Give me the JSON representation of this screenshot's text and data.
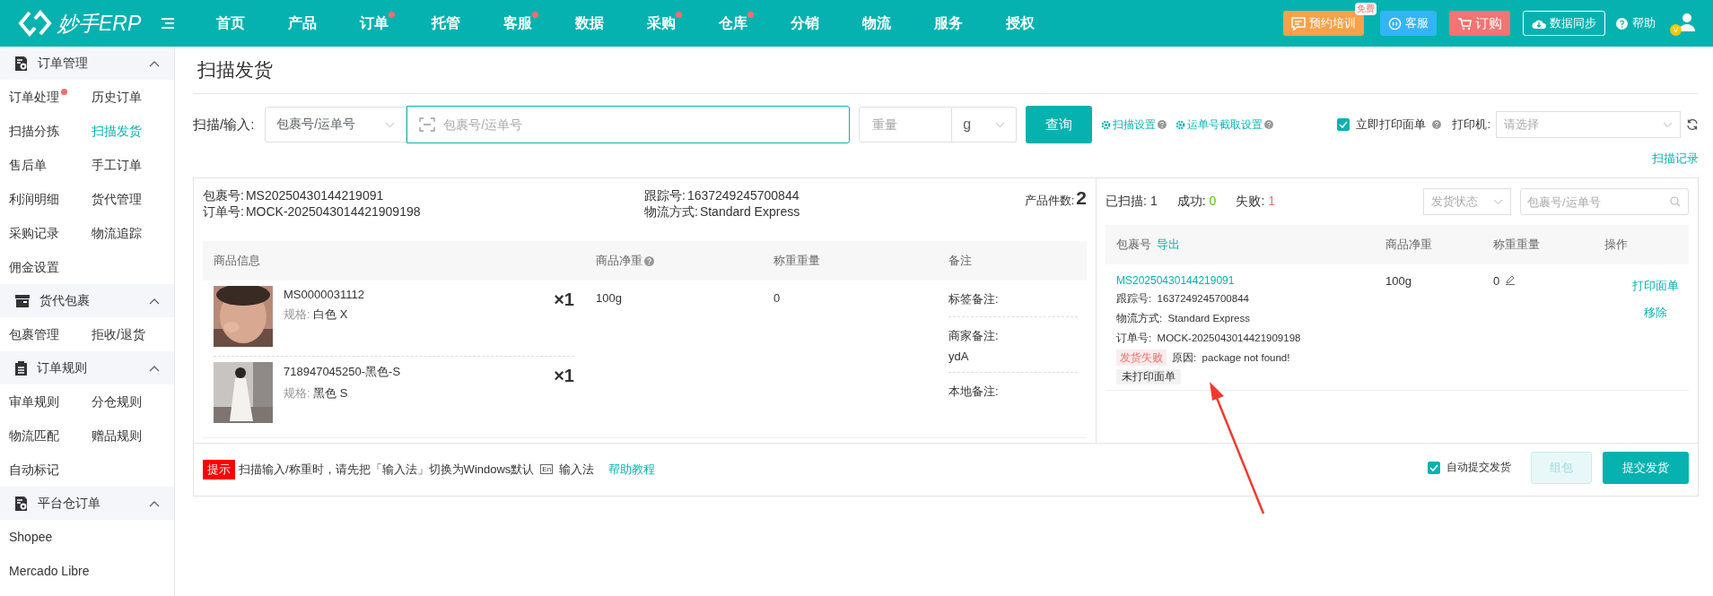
{
  "nav": {
    "logo": "妙手ERP",
    "items": [
      {
        "label": "首页",
        "dot": false
      },
      {
        "label": "产品",
        "dot": false
      },
      {
        "label": "订单",
        "dot": true
      },
      {
        "label": "托管",
        "dot": false
      },
      {
        "label": "客服",
        "dot": true
      },
      {
        "label": "数据",
        "dot": false
      },
      {
        "label": "采购",
        "dot": true
      },
      {
        "label": "仓库",
        "dot": true
      },
      {
        "label": "分销",
        "dot": false
      },
      {
        "label": "物流",
        "dot": false
      },
      {
        "label": "服务",
        "dot": false
      },
      {
        "label": "授权",
        "dot": false
      }
    ],
    "training": {
      "label": "预约培训",
      "badge": "免费"
    },
    "service": "客服",
    "order": "订购",
    "sync": "数据同步",
    "help": "帮助",
    "avatar_badge": "V"
  },
  "sidebar": {
    "groups": [
      {
        "title": "订单管理",
        "expanded": true,
        "items": [
          {
            "label": "订单处理",
            "dot": true,
            "selected": false
          },
          {
            "label": "历史订单",
            "dot": false,
            "selected": false
          },
          {
            "label": "扫描分拣",
            "dot": false,
            "selected": false
          },
          {
            "label": "扫描发货",
            "dot": false,
            "selected": true
          },
          {
            "label": "售后单",
            "dot": false,
            "selected": false
          },
          {
            "label": "手工订单",
            "dot": false,
            "selected": false
          },
          {
            "label": "利润明细",
            "dot": false,
            "selected": false
          },
          {
            "label": "货代管理",
            "dot": false,
            "selected": false
          },
          {
            "label": "采购记录",
            "dot": false,
            "selected": false
          },
          {
            "label": "物流追踪",
            "dot": false,
            "selected": false
          },
          {
            "label": "佣金设置",
            "dot": false,
            "selected": false
          }
        ]
      },
      {
        "title": "货代包裹",
        "expanded": true,
        "items": [
          {
            "label": "包裹管理",
            "dot": false,
            "selected": false
          },
          {
            "label": "拒收/退货",
            "dot": false,
            "selected": false
          }
        ]
      },
      {
        "title": "订单规则",
        "expanded": true,
        "items": [
          {
            "label": "审单规则",
            "dot": false,
            "selected": false
          },
          {
            "label": "分仓规则",
            "dot": false,
            "selected": false
          },
          {
            "label": "物流匹配",
            "dot": false,
            "selected": false
          },
          {
            "label": "赠品规则",
            "dot": false,
            "selected": false
          },
          {
            "label": "自动标记",
            "dot": false,
            "selected": false
          }
        ]
      },
      {
        "title": "平台仓订单",
        "expanded": true,
        "items": [
          {
            "label": "Shopee",
            "dot": false,
            "selected": false
          },
          {
            "label": "Mercado Libre",
            "dot": false,
            "selected": false
          }
        ]
      }
    ]
  },
  "page_title": "扫描发货",
  "scan_bar": {
    "label": "扫描/输入:",
    "type_select": "包裹号/运单号",
    "input_placeholder": "包裹号/运单号",
    "weight_placeholder": "重量",
    "unit": "g",
    "query": "查询",
    "links": [
      "扫描设置",
      "运单号截取设置"
    ],
    "print_immediately": {
      "label": "立即打印面单",
      "checked": true
    },
    "printer_label": "打印机:",
    "printer_placeholder": "请选择",
    "scan_log": "扫描记录"
  },
  "package": {
    "fields": [
      {
        "label": "包裹号:",
        "value": "MS20250430144219091"
      },
      {
        "label": "跟踪号:",
        "value": "1637249245700844"
      },
      {
        "label": "订单号:",
        "value": "MOCK-2025043014421909198"
      },
      {
        "label": "物流方式:",
        "value": "Standard Express"
      }
    ],
    "count_label": "产品件数:",
    "count": "2"
  },
  "items_table": {
    "columns": [
      "商品信息",
      "商品净重",
      "称重重量",
      "备注"
    ],
    "products": [
      {
        "kind": "picture",
        "sku": "MS0000031112",
        "spec_label": "规格:",
        "spec": "白色 X",
        "qty": "×1"
      },
      {
        "kind": "picture",
        "sku": "718947045250-黑色-S",
        "spec_label": "规格:",
        "spec": "黑色 S",
        "qty": "×1"
      }
    ],
    "net_weight": "100g",
    "weighed": "0",
    "notes": [
      {
        "label": "标签备注:"
      },
      {
        "label": "商家备注:",
        "value": "ydA"
      },
      {
        "label": "本地备注:"
      }
    ]
  },
  "tip": {
    "badge": "提示",
    "text": "扫描输入/称重时，请先把「输入法」切换为Windows默认",
    "key": "En",
    "ime": "输入法",
    "link": "帮助教程"
  },
  "results": {
    "stats": [
      {
        "label": "已扫描:",
        "value": "1",
        "color": "#333333"
      },
      {
        "label": "成功:",
        "value": "0",
        "color": "#52c41a"
      },
      {
        "label": "失败:",
        "value": "1",
        "color": "#f56c6c"
      }
    ],
    "status_placeholder": "发货状态",
    "search_placeholder": "包裹号/运单号",
    "columns": [
      "包裹号",
      "商品净重",
      "称重重量",
      "操作"
    ],
    "export": "导出",
    "row": {
      "package_no": "MS20250430144219091",
      "lines": [
        {
          "label": "跟踪号:",
          "value": "1637249245700844"
        },
        {
          "label": "物流方式:",
          "value": "Standard Express"
        },
        {
          "label": "订单号:",
          "value": "MOCK-2025043014421909198"
        }
      ],
      "status": "发货失败",
      "reason_label": "原因:",
      "reason": "package not found!",
      "print_status": "未打印面单",
      "net": "100g",
      "weighed": "0",
      "actions": [
        "打印面单",
        "移除"
      ]
    }
  },
  "footer": {
    "auto_submit": {
      "label": "自动提交发货",
      "checked": true
    },
    "group": {
      "label": "组包",
      "disabled": true
    },
    "submit": "提交发货"
  }
}
